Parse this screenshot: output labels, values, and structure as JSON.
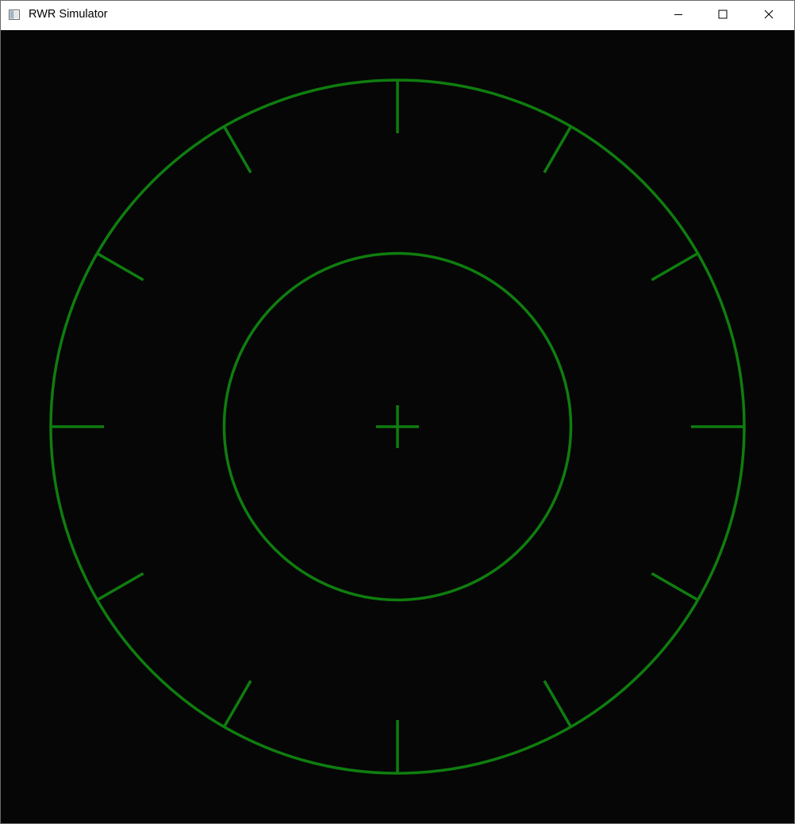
{
  "window": {
    "title": "RWR Simulator",
    "controls": {
      "minimize_icon": "minimize-icon",
      "maximize_icon": "maximize-icon",
      "close_icon": "close-icon"
    }
  },
  "scope": {
    "background_color": "#060606",
    "line_color": "#0f7d0f",
    "outer_tick_count": 12,
    "rings": [
      "outer-ring",
      "inner-ring"
    ],
    "center_marker": "crosshair"
  }
}
